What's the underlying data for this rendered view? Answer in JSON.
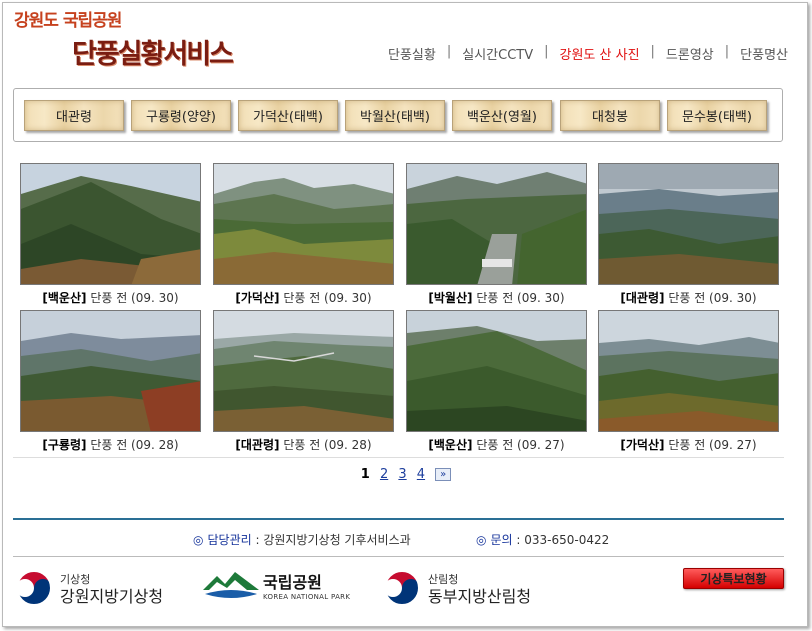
{
  "logo": {
    "subtitle": "강원도 국립공원",
    "title": "단풍실황서비스"
  },
  "top_nav": [
    {
      "label": "단풍실황",
      "active": false
    },
    {
      "label": "실시간CCTV",
      "active": false
    },
    {
      "label": "강원도 산 사진",
      "active": true
    },
    {
      "label": "드론영상",
      "active": false
    },
    {
      "label": "단풍명산",
      "active": false
    }
  ],
  "nav_separator": "|",
  "mountain_tabs": [
    "대관령",
    "구룡령(양양)",
    "가덕산(태백)",
    "박월산(태백)",
    "백운산(영월)",
    "대청봉",
    "문수봉(태백)"
  ],
  "photos": [
    {
      "name": "[백운산]",
      "desc": "단풍 전 (09. 30)",
      "scene": "green-ridge"
    },
    {
      "name": "[가덕산]",
      "desc": "단풍 전 (09. 30)",
      "scene": "valley-peaks"
    },
    {
      "name": "[박월산]",
      "desc": "단풍 전 (09. 30)",
      "scene": "town-valley"
    },
    {
      "name": "[대관령]",
      "desc": "단풍 전 (09. 30)",
      "scene": "cloudy-ridge"
    },
    {
      "name": "[구룡령]",
      "desc": "단풍 전 (09. 28)",
      "scene": "mountain-range"
    },
    {
      "name": "[대관령]",
      "desc": "단풍 전 (09. 28)",
      "scene": "wide-plateau"
    },
    {
      "name": "[백운산]",
      "desc": "단풍 전 (09. 27)",
      "scene": "green-slope"
    },
    {
      "name": "[가덕산]",
      "desc": "단풍 전 (09. 27)",
      "scene": "forest-peaks"
    }
  ],
  "pagination": {
    "current": "1",
    "pages": [
      "2",
      "3",
      "4"
    ],
    "next": "»"
  },
  "footer": {
    "manager_label": "담당관리",
    "manager_value": ": 강원지방기상청 기후서비스과",
    "contact_label": "문의",
    "contact_value": ": 033-650-0422",
    "marker": "◎"
  },
  "orgs": {
    "kma_small": "기상청",
    "kma_large": "강원지방기상청",
    "knp_korean": "국립공원",
    "knp_english": "KOREA NATIONAL PARK",
    "forest_small": "산림청",
    "forest_large": "동부지방산림청"
  },
  "alert_button": "기상특보현황",
  "colors": {
    "accent_red": "#e01010",
    "footer_line": "#2a6f95",
    "link_blue": "#14329a"
  }
}
